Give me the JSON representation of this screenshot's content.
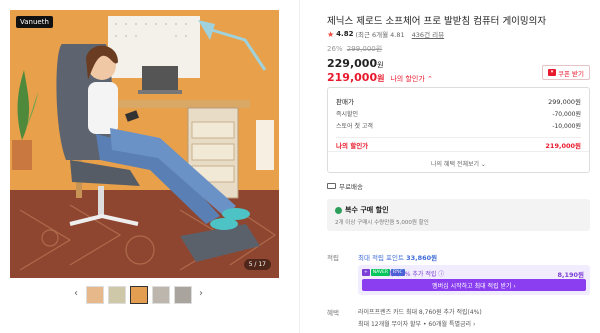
{
  "gallery": {
    "brand": "Vanueth",
    "counter": "5 / 17"
  },
  "product": {
    "title": "제닉스 제로드 소프체어 프로 발받침 컴퓨터 게이밍의자",
    "rating": "4.82",
    "rating_detail": "(최근 6개월 4.81",
    "reviews": "436건 리뷰",
    "discount_pct": "26%",
    "original_price": "299,000원",
    "price": "229,000",
    "price_unit": "원",
    "my_price": "219,000",
    "my_price_unit": "원",
    "my_price_label": "나의 할인가 ⌃",
    "coupon": "쿠폰 받기"
  },
  "price_box": {
    "rows": [
      {
        "k": "판매가",
        "v": "299,000원"
      },
      {
        "k": "즉시할인",
        "v": "-70,000원"
      },
      {
        "k": "스토어 첫 고객",
        "v": "-10,000원"
      }
    ],
    "my_row": {
      "k": "나의 할인가",
      "v": "219,000원"
    },
    "more": "나의 혜택 전체보기 ⌄"
  },
  "shipping": {
    "label": "무료배송"
  },
  "multi": {
    "title": "복수 구매 할인",
    "desc": "2개 이상 구매시 수량만큼 5,000원 할인"
  },
  "points": {
    "label": "적립",
    "max_prefix": "최대 적립 포인트",
    "max_value": "33,860원",
    "tag_a": "+",
    "tag_b": "NAVER",
    "tag_c": "BNC",
    "extra_text": "최대 5% 추가 적립 ⓘ",
    "extra_amount": "8,190원",
    "button": "멤버십 시작하고 최대 적립 받기 ›"
  },
  "benefits": {
    "label": "혜택",
    "line1": "라이프프렌즈 카드 최대 8,760원 추가 적립(4%)",
    "line2": "최대 12개월 무이자 할부 • 60개월 특별금리 ›"
  },
  "colors": {
    "accent_red": "#e8192c",
    "points_blue": "#3d6bd6",
    "membership_purple": "#8a3ef0"
  }
}
